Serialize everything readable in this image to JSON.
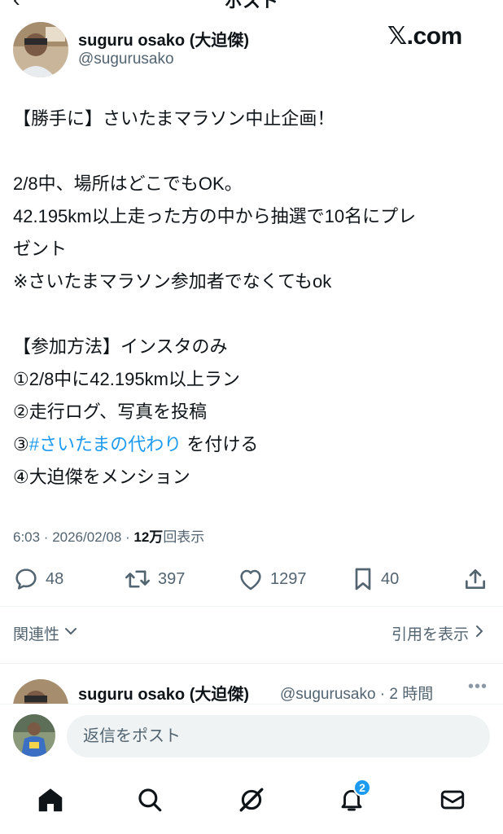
{
  "header": {
    "title": "ポスト",
    "back_glyph": "‹"
  },
  "author": {
    "name": "suguru osako (大迫傑)",
    "handle": "@sugurusako",
    "site": "𝕏.com"
  },
  "tweet": {
    "line1": "【勝手に】さいたまマラソン中止企画！",
    "line2": "2/8中、場所はどこでもOK。",
    "line3": "42.195km以上走った方の中から抽選で10名にプレ",
    "line4": "ゼント",
    "line5": "※さいたまマラソン参加者でなくてもok",
    "line6": "【参加方法】インスタのみ",
    "line7": "①2/8中に42.195km以上ラン",
    "line8": "②走行ログ、写真を投稿",
    "line9_prefix": "③",
    "line9_hashtag": "#さいたまの代わり",
    "line9_suffix": " を付ける",
    "line10": "④大迫傑をメンション",
    "accent_color": "#1d9bf0"
  },
  "meta": {
    "time": "6:03 · 2026/02/08 · ",
    "views_count": "12万",
    "views_label": "回表示"
  },
  "actions": {
    "replies": "48",
    "reposts": "397",
    "likes": "1297",
    "bookmarks": "40"
  },
  "sort": {
    "related_label": "関連性",
    "quotes_label": "引用を表示"
  },
  "reply_preview": {
    "name": "suguru osako (大迫傑)",
    "handle_time": "@sugurusako · 2 時間"
  },
  "composer": {
    "placeholder": "返信をポスト"
  },
  "tabbar": {
    "notification_count": "2"
  }
}
